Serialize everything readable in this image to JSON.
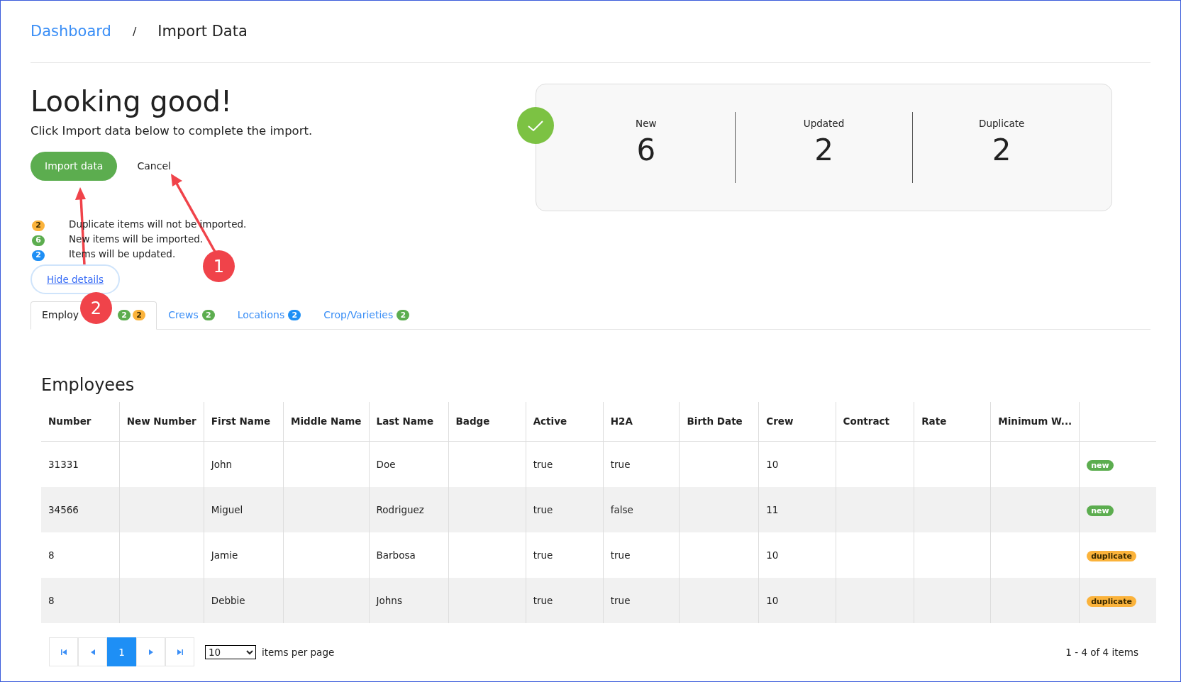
{
  "breadcrumb": [
    {
      "label": "Dashboard",
      "kind": "link"
    },
    {
      "label": "/",
      "kind": "separator"
    },
    {
      "label": "Import Data",
      "kind": "current"
    }
  ],
  "heading": "Looking good!",
  "subtitle": "Click Import data below to complete the import.",
  "buttons": {
    "primary": "Import data",
    "secondary": "Cancel"
  },
  "summary": [
    {
      "label": "New",
      "value": "6"
    },
    {
      "label": "Updated",
      "value": "2"
    },
    {
      "label": "Duplicate",
      "value": "2"
    }
  ],
  "legend": [
    {
      "count": "2",
      "color": "#fbb33b",
      "text": "Duplicate items will not be imported."
    },
    {
      "count": "6",
      "color": "#5cad4f",
      "text": "New items will be imported."
    },
    {
      "count": "2",
      "color": "#1e8ff5",
      "text": "Items will be updated."
    }
  ],
  "details_toggle": "Hide details",
  "tabs": [
    {
      "label": "Employ",
      "selected": true,
      "badges": [
        {
          "count": "2",
          "color": "#5cad4f"
        },
        {
          "count": "2",
          "color": "#fbb33b"
        }
      ]
    },
    {
      "label": "Crews",
      "selected": false,
      "badges": [
        {
          "count": "2",
          "color": "#5cad4f"
        }
      ]
    },
    {
      "label": "Locations",
      "selected": false,
      "badges": [
        {
          "count": "2",
          "color": "#1e8ff5"
        }
      ]
    },
    {
      "label": "Crop/Varieties",
      "selected": false,
      "badges": [
        {
          "count": "2",
          "color": "#5cad4f"
        }
      ]
    }
  ],
  "table": {
    "title": "Employees",
    "columns": [
      "Number",
      "New Number",
      "First Name",
      "Middle Name",
      "Last Name",
      "Badge",
      "Active",
      "H2A",
      "Birth Date",
      "Crew",
      "Contract",
      "Rate",
      "Minimum W..."
    ],
    "rows": [
      {
        "cells": [
          "31331",
          "",
          "John",
          "",
          "Doe",
          "",
          "true",
          "true",
          "",
          "10",
          "",
          "",
          ""
        ],
        "status": {
          "label": "new",
          "color": "#5cad4f"
        }
      },
      {
        "cells": [
          "34566",
          "",
          "Miguel",
          "",
          "Rodriguez",
          "",
          "true",
          "false",
          "",
          "11",
          "",
          "",
          ""
        ],
        "status": {
          "label": "new",
          "color": "#5cad4f"
        }
      },
      {
        "cells": [
          "8",
          "",
          "Jamie",
          "",
          "Barbosa",
          "",
          "true",
          "true",
          "",
          "10",
          "",
          "",
          ""
        ],
        "status": {
          "label": "duplicate",
          "color": "#fbb33b"
        }
      },
      {
        "cells": [
          "8",
          "",
          "Debbie",
          "",
          "Johns",
          "",
          "true",
          "true",
          "",
          "10",
          "",
          "",
          ""
        ],
        "status": {
          "label": "duplicate",
          "color": "#fbb33b"
        }
      }
    ]
  },
  "pagination": {
    "pages": [
      {
        "label": "1",
        "selected": true
      }
    ],
    "page_size": "10",
    "page_size_label": "items per page",
    "range": "1 - 4 of 4 items"
  },
  "annotations": [
    {
      "number": "1"
    },
    {
      "number": "2"
    }
  ]
}
